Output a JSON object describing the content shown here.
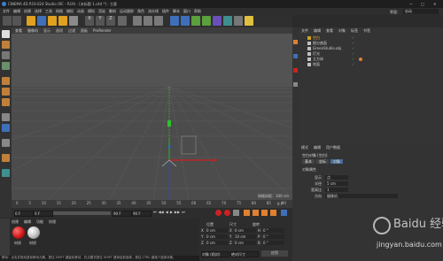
{
  "window": {
    "title": "CINEMA 4D R19.024 Studio (RC - R19) - [未标题 1.c4d *] - 主要"
  },
  "menubar": {
    "items": [
      "文件",
      "编辑",
      "创建",
      "选择",
      "工具",
      "网格",
      "捕捉",
      "动画",
      "模拟",
      "渲染",
      "雕刻",
      "运动跟踪",
      "角色",
      "流水线",
      "插件",
      "脚本",
      "窗口",
      "帮助"
    ],
    "layout_label": "界面:",
    "layout_value": "启动"
  },
  "viewport": {
    "menu": [
      "查看",
      "摄像机",
      "显示",
      "选项",
      "过滤",
      "面板",
      "ProRender"
    ],
    "camera_label": "透视视图",
    "grid_label": "网格间距：100 cm"
  },
  "timeline": {
    "ticks": [
      "0",
      "5",
      "10",
      "15",
      "20",
      "25",
      "30",
      "35",
      "40",
      "45",
      "50",
      "55",
      "60",
      "65",
      "70",
      "75",
      "80",
      "85",
      "90"
    ],
    "current_frame": "0 F"
  },
  "transport": {
    "start_field": "0 F",
    "start_end": "0 F",
    "end_field": "90 F",
    "end_end": "90 F"
  },
  "materials": {
    "menu": [
      "创建",
      "编辑",
      "功能",
      "纹理"
    ],
    "items": [
      {
        "name": "材质",
        "color": "#d01a1a"
      },
      {
        "name": "材质",
        "color": "#bdbdbd"
      }
    ]
  },
  "coordinates": {
    "labels": [
      "位置",
      "尺寸",
      "旋转"
    ],
    "rows": [
      {
        "axis": "X",
        "pos": "0 cm",
        "size": "0 cm",
        "rot_label": "H",
        "rot": "0 °"
      },
      {
        "axis": "Y",
        "pos": "0 cm",
        "size": "10 cm",
        "rot_label": "P",
        "rot": "0 °"
      },
      {
        "axis": "Z",
        "pos": "0 cm",
        "size": "0 cm",
        "rot_label": "B",
        "rot": "0 °"
      }
    ],
    "mode": "对象 (相对)",
    "mode2": "绝对尺寸",
    "apply": "应用"
  },
  "objects": {
    "menu": [
      "文件",
      "编辑",
      "查看",
      "对象",
      "标签",
      "书签"
    ],
    "items": [
      {
        "name": "空白",
        "color": "#d0a020"
      },
      {
        "name": "细分曲面",
        "color": "#c0c0c0"
      },
      {
        "name": "GreenStudio.obj",
        "color": "#c0c0c0"
      },
      {
        "name": "灯光",
        "color": "#c0c0c0"
      },
      {
        "name": "立方体",
        "color": "#c0c0c0"
      },
      {
        "name": "地面",
        "color": "#c0c0c0"
      }
    ]
  },
  "attributes": {
    "menu": [
      "模式",
      "编辑",
      "用户数据"
    ],
    "object_name": "空白对象 [空白]",
    "tabs": [
      "基本",
      "坐标",
      "对象"
    ],
    "section": "对象属性",
    "fields": [
      {
        "label": "显示",
        "value": "点"
      },
      {
        "label": "半径",
        "value": "5 cm"
      },
      {
        "label": "宽高比",
        "value": "1"
      },
      {
        "label": "方向",
        "value": "摄像机"
      }
    ]
  },
  "status": {
    "text": "移动：点击并拖动鼠标移动元素。按住 SHIFT 键量化移动，在点模式按住 SHIFT 键添加到选择，按住 CTRL 键减少选择对象。"
  },
  "watermark": {
    "text": "Baidu 经验",
    "url": "jingyan.baidu.com"
  }
}
